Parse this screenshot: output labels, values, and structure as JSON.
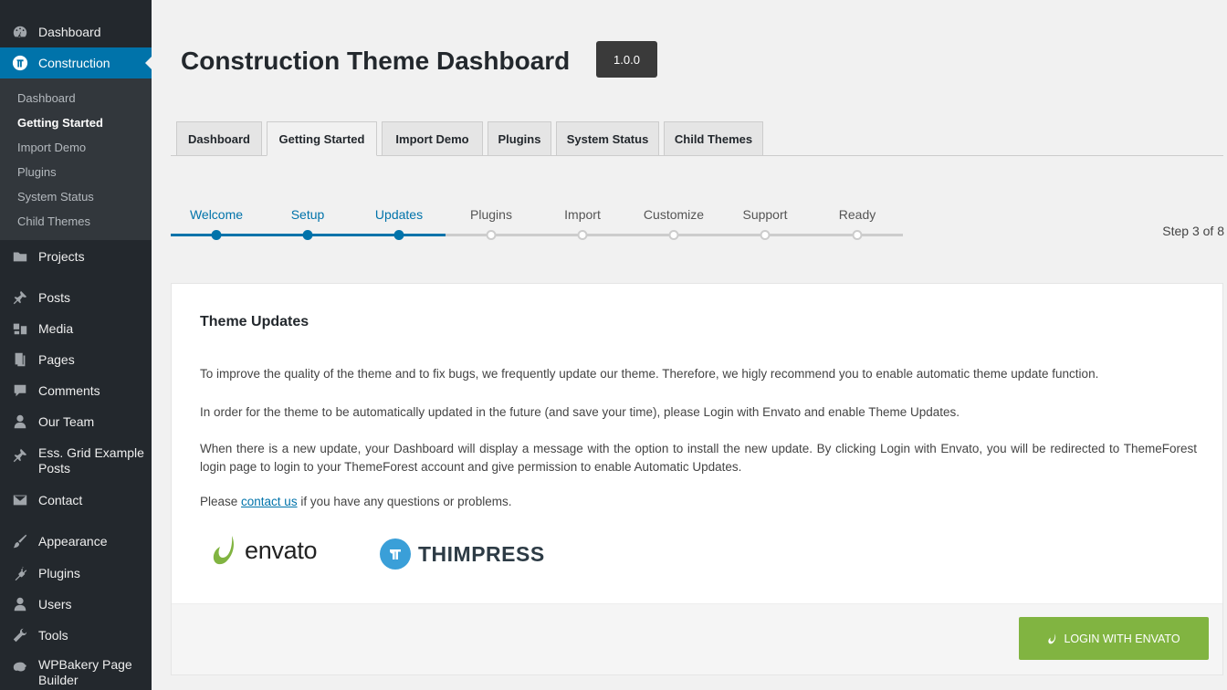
{
  "sidebar": {
    "dashboard": "Dashboard",
    "construction": "Construction",
    "submenu": [
      "Dashboard",
      "Getting Started",
      "Import Demo",
      "Plugins",
      "System Status",
      "Child Themes"
    ],
    "projects": "Projects",
    "posts": "Posts",
    "media": "Media",
    "pages": "Pages",
    "comments": "Comments",
    "our_team": "Our Team",
    "ess_grid_line1": "Ess. Grid Example",
    "ess_grid_line2": "Posts",
    "contact": "Contact",
    "appearance": "Appearance",
    "plugins": "Plugins",
    "users": "Users",
    "tools": "Tools",
    "wpbakery_line1": "WPBakery Page",
    "wpbakery_line2": "Builder"
  },
  "header": {
    "title": "Construction Theme Dashboard",
    "version": "1.0.0"
  },
  "tabs": [
    "Dashboard",
    "Getting Started",
    "Import Demo",
    "Plugins",
    "System Status",
    "Child Themes"
  ],
  "steps": {
    "labels": [
      "Welcome",
      "Setup",
      "Updates",
      "Plugins",
      "Import",
      "Customize",
      "Support",
      "Ready"
    ],
    "current": 3,
    "total": 8,
    "counter": "Step 3 of 8"
  },
  "panel": {
    "title": "Theme Updates",
    "p1": "To improve the quality of the theme and to fix bugs, we frequently update our theme. Therefore, we higly recommend you to enable automatic theme update function.",
    "p2": "In order for the theme to be automatically updated in the future (and save your time), please Login with Envato and enable Theme Updates.",
    "p3": "When there is a new update, your Dashboard will display a message with the option to install the new update. By clicking Login with Envato, you will be redirected to ThemeForest login page to login to your ThemeForest account and give permission to enable Automatic Updates.",
    "p4_before": "Please ",
    "p4_link": "contact us",
    "p4_after": " if you have any questions or problems.",
    "envato_logo": "envato",
    "thimpress_logo": "THIMPRESS",
    "login_button": "LOGIN WITH ENVATO"
  },
  "colors": {
    "sidebar_bg": "#23282d",
    "submenu_bg": "#32373c",
    "accent": "#0073aa",
    "envato_green": "#81b441",
    "thimpress_blue": "#3a9fd8"
  }
}
